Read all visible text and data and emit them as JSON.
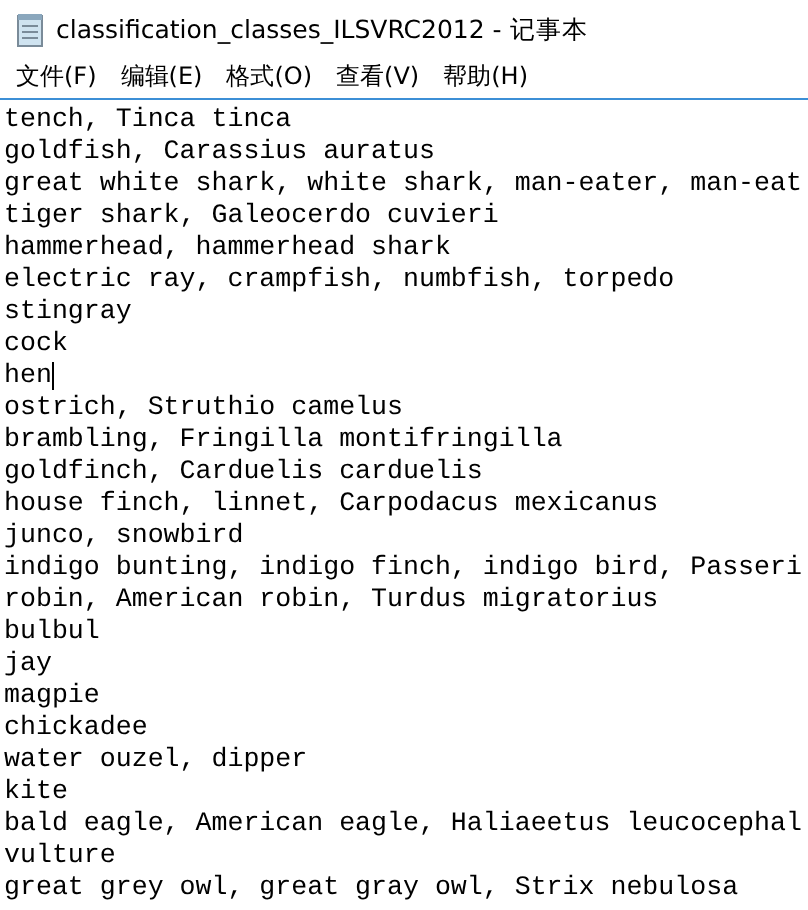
{
  "window": {
    "title": "classification_classes_ILSVRC2012 - 记事本"
  },
  "menu": [
    "文件(F)",
    "编辑(E)",
    "格式(O)",
    "查看(V)",
    "帮助(H)"
  ],
  "lines": [
    {
      "text": "tench, Tinca tinca",
      "caret": false
    },
    {
      "text": "goldfish, Carassius auratus",
      "caret": false
    },
    {
      "text": "great white shark, white shark, man-eater, man-eat",
      "caret": false
    },
    {
      "text": "tiger shark, Galeocerdo cuvieri",
      "caret": false
    },
    {
      "text": "hammerhead, hammerhead shark",
      "caret": false
    },
    {
      "text": "electric ray, crampfish, numbfish, torpedo",
      "caret": false
    },
    {
      "text": "stingray",
      "caret": false
    },
    {
      "text": "cock",
      "caret": false
    },
    {
      "text": "hen",
      "caret": true
    },
    {
      "text": "ostrich, Struthio camelus",
      "caret": false
    },
    {
      "text": "brambling, Fringilla montifringilla",
      "caret": false
    },
    {
      "text": "goldfinch, Carduelis carduelis",
      "caret": false
    },
    {
      "text": "house finch, linnet, Carpodacus mexicanus",
      "caret": false
    },
    {
      "text": "junco, snowbird",
      "caret": false
    },
    {
      "text": "indigo bunting, indigo finch, indigo bird, Passeri",
      "caret": false
    },
    {
      "text": "robin, American robin, Turdus migratorius",
      "caret": false
    },
    {
      "text": "bulbul",
      "caret": false
    },
    {
      "text": "jay",
      "caret": false
    },
    {
      "text": "magpie",
      "caret": false
    },
    {
      "text": "chickadee",
      "caret": false
    },
    {
      "text": "water ouzel, dipper",
      "caret": false
    },
    {
      "text": "kite",
      "caret": false
    },
    {
      "text": "bald eagle, American eagle, Haliaeetus leucocephal",
      "caret": false
    },
    {
      "text": "vulture",
      "caret": false
    },
    {
      "text": "great grey owl, great gray owl, Strix nebulosa",
      "caret": false
    }
  ]
}
